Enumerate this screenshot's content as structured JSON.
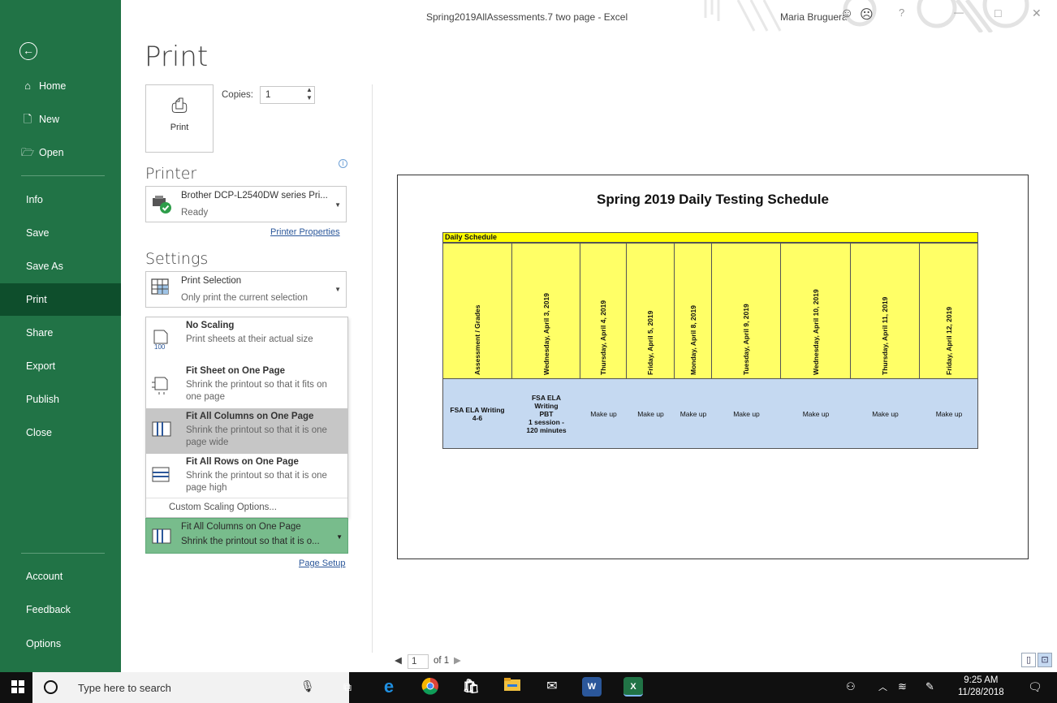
{
  "window": {
    "title": "Spring2019AllAssessments.7 two page  -  Excel",
    "user": "Maria Bruguera",
    "help": "?",
    "minimize": "—",
    "restore": "□",
    "close": "✕"
  },
  "sidebar": {
    "back_icon": "←",
    "items": [
      {
        "label": "Home",
        "icon": "home-icon"
      },
      {
        "label": "New",
        "icon": "new-doc-icon"
      },
      {
        "label": "Open",
        "icon": "folder-icon"
      },
      {
        "label": "Info"
      },
      {
        "label": "Save"
      },
      {
        "label": "Save As"
      },
      {
        "label": "Print",
        "active": true
      },
      {
        "label": "Share"
      },
      {
        "label": "Export"
      },
      {
        "label": "Publish"
      },
      {
        "label": "Close"
      },
      {
        "label": "Account"
      },
      {
        "label": "Feedback"
      },
      {
        "label": "Options"
      }
    ]
  },
  "print": {
    "heading": "Print",
    "button_label": "Print",
    "copies_label": "Copies:",
    "copies_value": "1"
  },
  "printer": {
    "heading": "Printer",
    "name": "Brother DCP-L2540DW series Pri...",
    "status": "Ready",
    "properties_link": "Printer Properties"
  },
  "settings": {
    "heading": "Settings",
    "selection": {
      "main": "Print Selection",
      "sub": "Only print the current selection"
    },
    "scaling_options": [
      {
        "title": "No Scaling",
        "desc": "Print sheets at their actual size",
        "icon": "no-scaling-icon",
        "icon_text": "100"
      },
      {
        "title": "Fit Sheet on One Page",
        "desc": "Shrink the printout so that it fits on one page",
        "icon": "fit-sheet-icon"
      },
      {
        "title": "Fit All Columns on One Page",
        "desc": "Shrink the printout so that it is one page wide",
        "icon": "fit-columns-icon",
        "highlighted": true
      },
      {
        "title": "Fit All Rows on One Page",
        "desc": "Shrink the printout so that it is one page high",
        "icon": "fit-rows-icon"
      }
    ],
    "custom_scaling": "Custom Scaling Options...",
    "selected_scaling": {
      "main": "Fit All Columns on One Page",
      "sub": "Shrink the printout so that it is o..."
    },
    "page_setup_link": "Page Setup"
  },
  "preview": {
    "sheet_title": "Spring 2019 Daily Testing Schedule",
    "schedule_label": "Daily Schedule",
    "headers": [
      "Assessment / Grades",
      "Wednesday, April 3, 2019",
      "Thursday, April 4, 2019",
      "Friday, April 5, 2019",
      "Monday, April 8, 2019",
      "Tuesday, April 9, 2019",
      "Wednesday, April 10, 2019",
      "Thursday, April 11, 2019",
      "Friday, April 12, 2019"
    ],
    "row": [
      "FSA ELA Writing\n4-6",
      "FSA ELA\nWriting\nPBT\n1 session -\n120 minutes",
      "Make up",
      "Make up",
      "Make up",
      "Make up",
      "Make up",
      "Make up",
      "Make up"
    ],
    "page_number": "1",
    "page_of": "of 1"
  },
  "taskbar": {
    "search_placeholder": "Type here to search",
    "time": "9:25 AM",
    "date": "11/28/2018"
  },
  "colors": {
    "sidebar": "#217346",
    "sidebar_active": "#0e4e2c",
    "header_yellow": "#ffff66",
    "row_blue": "#c5d9f1",
    "selected_scaling": "#78bc8c"
  }
}
